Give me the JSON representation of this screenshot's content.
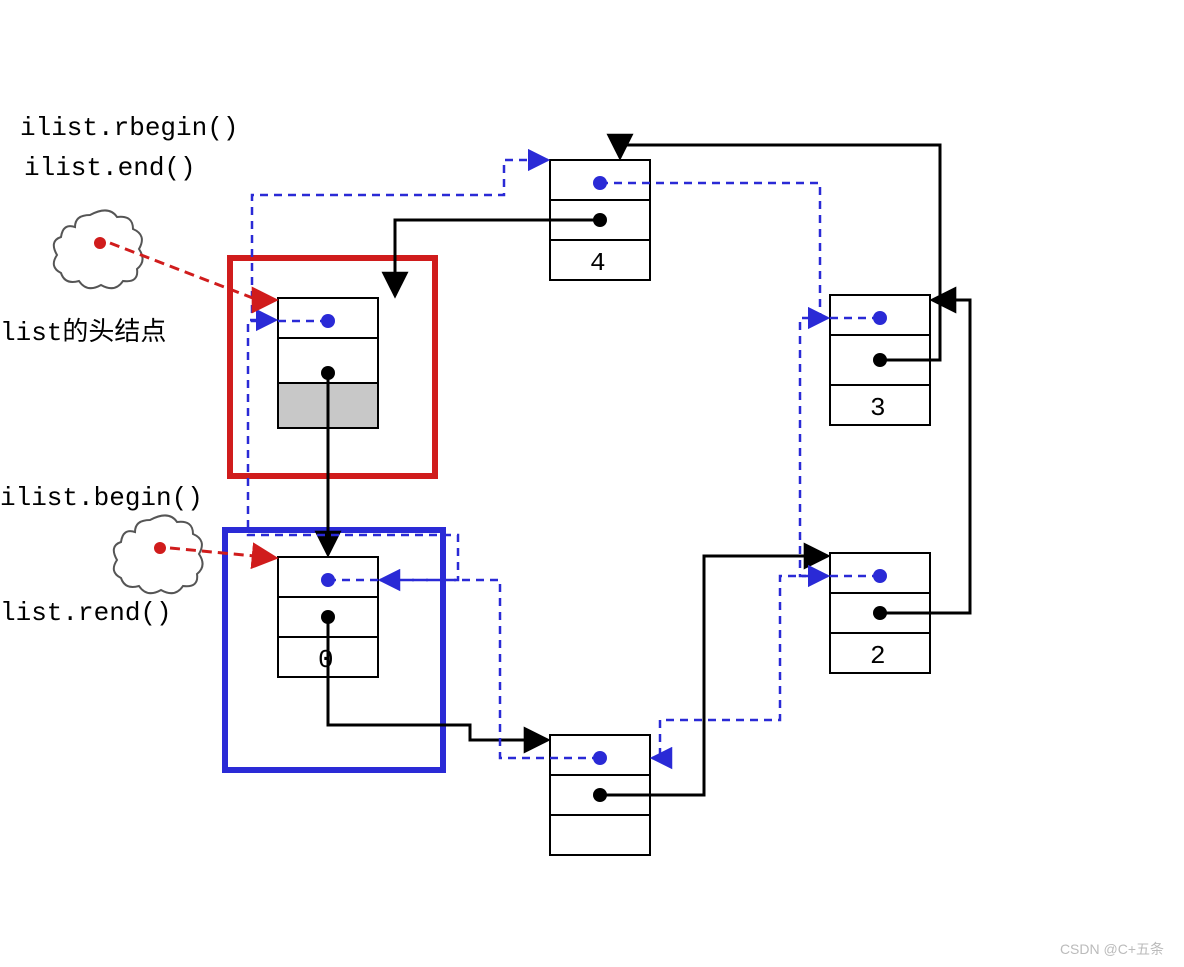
{
  "labels": {
    "rbegin": "ilist.rbegin()",
    "end": "ilist.end()",
    "head_caption": "list的头结点",
    "begin": "ilist.begin()",
    "rend": "list.rend()"
  },
  "nodes": {
    "n0": "0",
    "n1": "",
    "n2": "2",
    "n3": "3",
    "n4": "4",
    "head": ""
  },
  "watermark": "CSDN @C+五条",
  "colors": {
    "blue": "#2a2ad6",
    "red": "#d01c1c",
    "black": "#000000",
    "grey": "#c8c8c8"
  }
}
